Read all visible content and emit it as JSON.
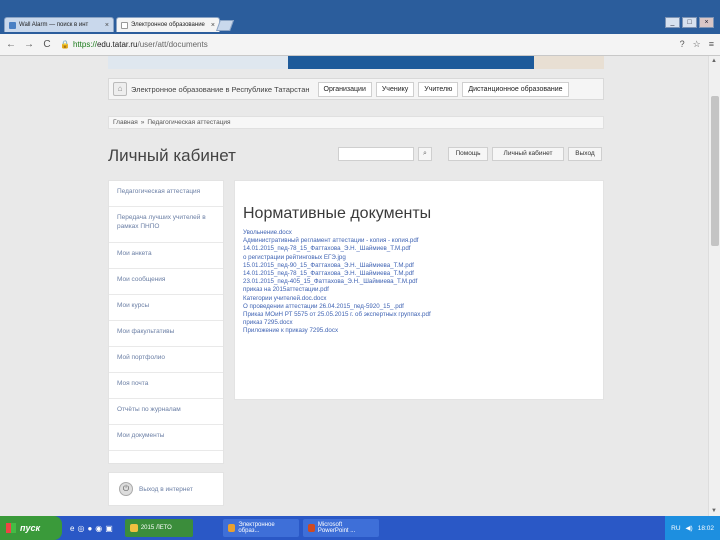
{
  "browser": {
    "tabs": [
      {
        "label": "Wall Alarm — поиск в инт"
      },
      {
        "label": "Электронное образование"
      }
    ],
    "tab_close": "×",
    "window_buttons": [
      "_",
      "□",
      "×"
    ],
    "nav": {
      "back": "←",
      "forward": "→",
      "reload": "C"
    },
    "address": {
      "scheme": "https://",
      "host": "edu.tatar.ru",
      "path": "/user/att/documents"
    },
    "toolbar_icons": [
      "?",
      "☆",
      "≡"
    ]
  },
  "portal": {
    "title": "Электронное образование в Республике Татарстан",
    "links": [
      "Организации",
      "Ученику",
      "Учителю",
      "Дистанционное образование"
    ]
  },
  "breadcrumb": {
    "home": "Главная",
    "sep": "»",
    "current": "Педагогическая аттестация"
  },
  "page_title": "Личный кабинет",
  "search": {
    "button_icon": "search-icon"
  },
  "header_buttons": {
    "help": "Помощь",
    "cabinet": "Личный кабинет",
    "exit": "Выход"
  },
  "sidebar": {
    "items": [
      "Педагогическая аттестация",
      "Передача лучших учителей в рамках ПНПО",
      "Мои анкета",
      "Мои сообщения",
      "Мои курсы",
      "Мои факультативы",
      "Мой портфолио",
      "Моя почта",
      "Отчёты по журналам",
      "Мои документы"
    ],
    "exit": "Выход в интернет"
  },
  "content": {
    "title": "Нормативные документы",
    "documents": [
      "Увольнение.docx",
      "Административный регламент аттестации - копия - копия.pdf",
      "14.01.2015_пед-78_15_Фаттахова_Э.Н._Шаймиев_Т.М.pdf",
      "о регистрации рейтинговых ЕГЭ.jpg",
      "15.01.2015_пед-90_15_Фаттахова_Э.Н._Шаймиева_Т.М.pdf",
      "14.01.2015_пед-78_15_Фаттахова_Э.Н._Шаймиева_Т.М.pdf",
      "23.01.2015_пед-405_15_Фаттахова_Э.Н._Шаймиева_Т.М.pdf",
      "приказ на 2015аттестации.pdf",
      "Категории учителей.doc.docx",
      "О проведении аттестации 26.04.2015_пед-5920_15_.pdf",
      "Приказ МОиН РТ 5575 от 25.05.2015 г. об экспертных группах.pdf",
      "приказ 7295.docx",
      "Приложение к приказу 7295.docx"
    ]
  },
  "taskbar": {
    "start": "пуск",
    "quick_launch": [
      "e",
      "◎",
      "●",
      "◉",
      "▣"
    ],
    "items": [
      "2015 ЛЕТО",
      "Электронное образ...",
      "Microsoft PowerPoint ..."
    ],
    "tray": {
      "lang": "RU",
      "time": "18:02"
    }
  }
}
